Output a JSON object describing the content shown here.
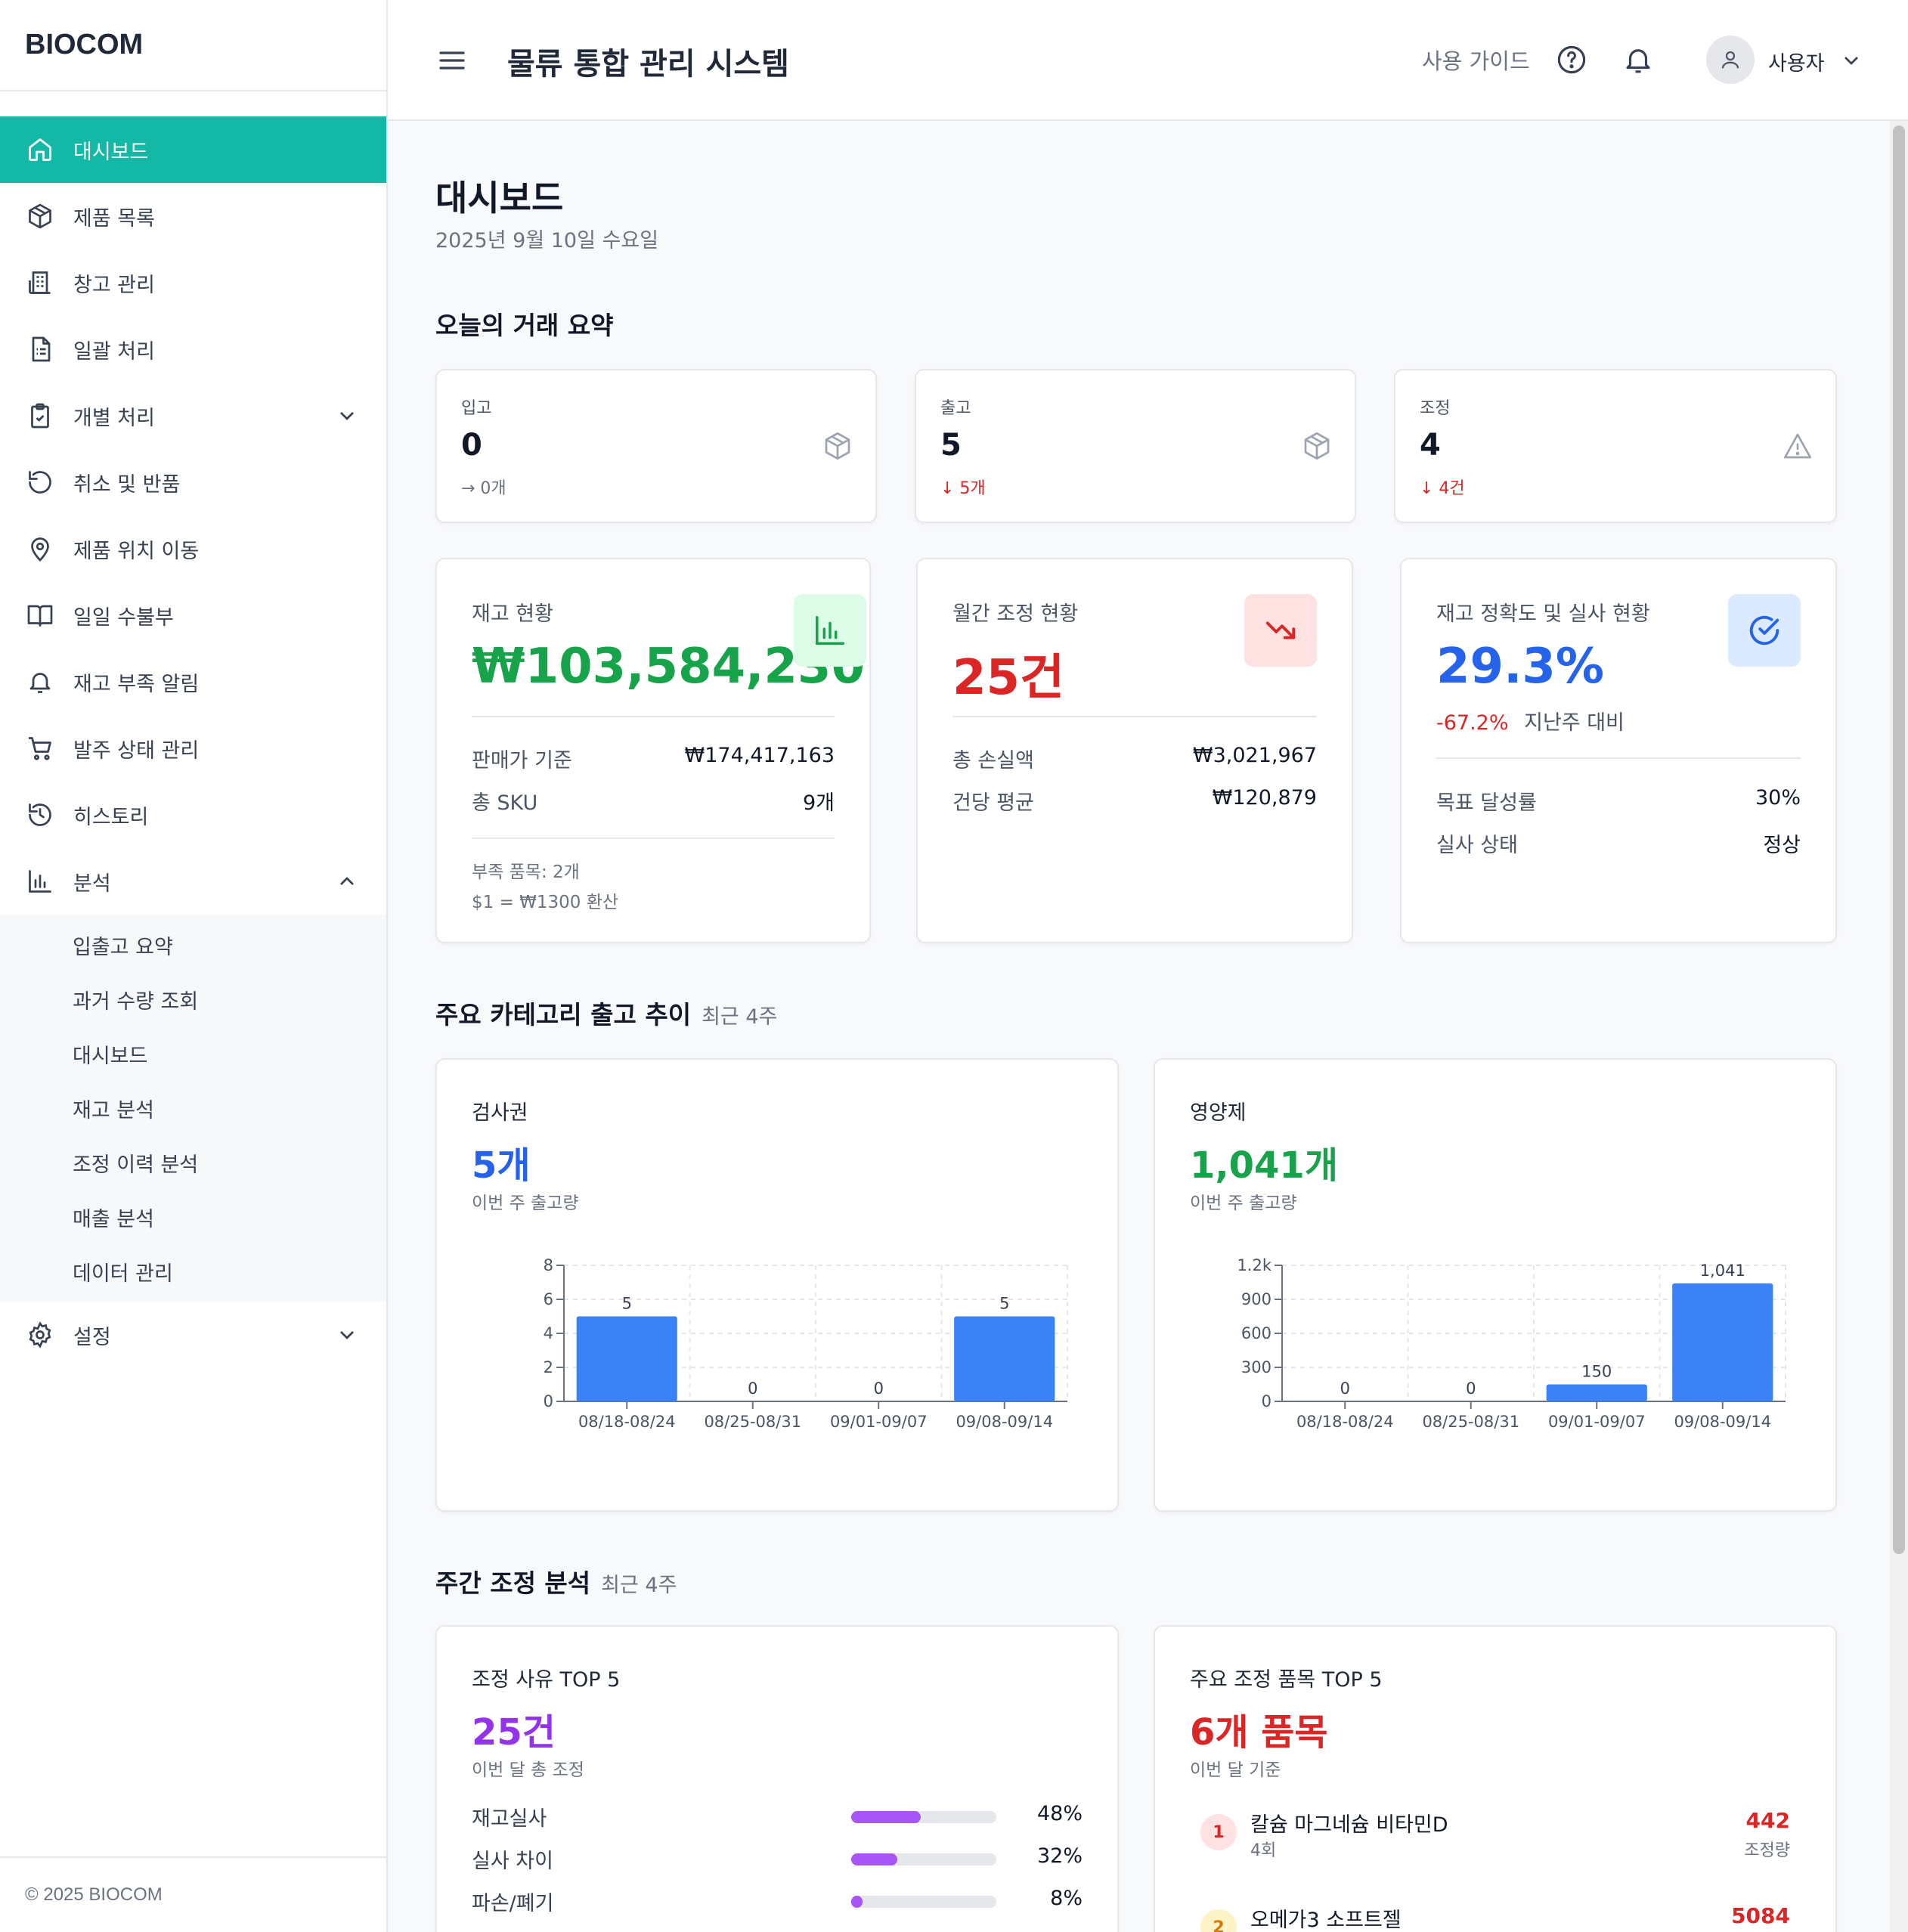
{
  "sidebar": {
    "logo": "BIOCOM",
    "items": [
      {
        "label": "대시보드",
        "icon": "home-icon"
      },
      {
        "label": "제품 목록",
        "icon": "box-icon"
      },
      {
        "label": "창고 관리",
        "icon": "building-icon"
      },
      {
        "label": "일괄 처리",
        "icon": "file-list-icon"
      },
      {
        "label": "개별 처리",
        "icon": "clipboard-icon"
      },
      {
        "label": "취소 및 반품",
        "icon": "undo-icon"
      },
      {
        "label": "제품 위치 이동",
        "icon": "map-pin-icon"
      },
      {
        "label": "일일 수불부",
        "icon": "book-icon"
      },
      {
        "label": "재고 부족 알림",
        "icon": "bell-icon"
      },
      {
        "label": "발주 상태 관리",
        "icon": "cart-icon"
      },
      {
        "label": "히스토리",
        "icon": "history-icon"
      },
      {
        "label": "분석",
        "icon": "bar-chart-icon"
      }
    ],
    "analysis_sub": [
      "입출고 요약",
      "과거 수량 조회",
      "대시보드",
      "재고 분석",
      "조정 이력 분석",
      "매출 분석",
      "데이터 관리"
    ],
    "settings_label": "설정",
    "footer": "© 2025 BIOCOM"
  },
  "header": {
    "title": "물류 통합 관리 시스템",
    "guide": "사용 가이드",
    "user": "사용자"
  },
  "page": {
    "title": "대시보드",
    "date": "2025년 9월 10일 수요일"
  },
  "today": {
    "title": "오늘의 거래 요약",
    "cards": [
      {
        "label": "입고",
        "value": "0",
        "delta": "→ 0개"
      },
      {
        "label": "출고",
        "value": "5",
        "delta": "↓ 5개"
      },
      {
        "label": "조정",
        "value": "4",
        "delta": "↓ 4건"
      }
    ]
  },
  "inventory": {
    "label": "재고 현황",
    "value": "₩103,584,230",
    "rows": [
      {
        "k": "판매가 기준",
        "v": "₩174,417,163"
      },
      {
        "k": "총 SKU",
        "v": "9개"
      }
    ],
    "note1": "부족 품목: 2개",
    "note2": "$1 = ₩1300 환산"
  },
  "monthly_adjust": {
    "label": "월간 조정 현황",
    "value": "25건",
    "rows": [
      {
        "k": "총 손실액",
        "v": "₩3,021,967"
      },
      {
        "k": "건당 평균",
        "v": "₩120,879"
      }
    ]
  },
  "accuracy": {
    "label": "재고 정확도 및 실사 현황",
    "value": "29.3%",
    "delta": "-67.2%",
    "delta_label": "지난주 대비",
    "rows": [
      {
        "k": "목표 달성률",
        "v": "30%"
      },
      {
        "k": "실사 상태",
        "v": "정상"
      }
    ]
  },
  "category": {
    "title": "주요 카테고리 출고 추이",
    "subtitle": "최근 4주",
    "cards": [
      {
        "label": "검사권",
        "value": "5개",
        "sub": "이번 주 출고량",
        "color": "#2563eb"
      },
      {
        "label": "영양제",
        "value": "1,041개",
        "sub": "이번 주 출고량",
        "color": "#16a34a"
      }
    ]
  },
  "adjust_analysis": {
    "title": "주간 조정 분석",
    "subtitle": "최근 4주",
    "reasons_card": {
      "label": "조정 사유 TOP 5",
      "value": "25건",
      "sub": "이번 달 총 조정",
      "reasons": [
        {
          "name": "재고실사",
          "pct": "48%",
          "ratio": 0.48
        },
        {
          "name": "실사 차이",
          "pct": "32%",
          "ratio": 0.32
        },
        {
          "name": "파손/폐기",
          "pct": "8%",
          "ratio": 0.08
        }
      ]
    },
    "items_card": {
      "label": "주요 조정 품목 TOP 5",
      "value": "6개 품목",
      "sub": "이번 달 기준",
      "items": [
        {
          "rank": "1",
          "name": "칼슘 마그네슘 비타민D",
          "count": "4회",
          "qty": "442",
          "qty_label": "조정량"
        },
        {
          "rank": "2",
          "name": "오메가3 소프트젤",
          "count": "",
          "qty": "5084",
          "qty_label": ""
        }
      ]
    }
  },
  "chart_data": [
    {
      "type": "bar",
      "title": "검사권",
      "categories": [
        "08/18-08/24",
        "08/25-08/31",
        "09/01-09/07",
        "09/08-09/14"
      ],
      "values": [
        5,
        0,
        0,
        5
      ],
      "yticks": [
        "0",
        "2",
        "4",
        "6",
        "8"
      ],
      "ylim": [
        0,
        8
      ],
      "color": "#3b82f6",
      "grid": true
    },
    {
      "type": "bar",
      "title": "영양제",
      "categories": [
        "08/18-08/24",
        "08/25-08/31",
        "09/01-09/07",
        "09/08-09/14"
      ],
      "values": [
        0,
        0,
        150,
        1041
      ],
      "value_labels": [
        "0",
        "0",
        "150",
        "1,041"
      ],
      "yticks": [
        "0",
        "300",
        "600",
        "900",
        "1.2k"
      ],
      "ylim": [
        0,
        1200
      ],
      "color": "#3b82f6",
      "grid": true
    }
  ]
}
